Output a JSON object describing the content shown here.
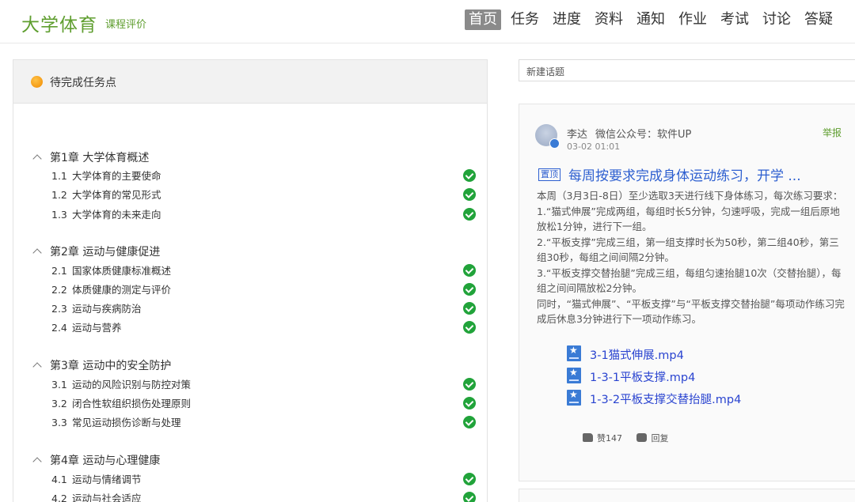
{
  "header": {
    "brand": "大学体育",
    "subtitle": "课程评价",
    "nav": [
      "首页",
      "任务",
      "进度",
      "资料",
      "通知",
      "作业",
      "考试",
      "讨论",
      "答疑"
    ],
    "active_nav": "首页"
  },
  "tasks": {
    "title": "待完成任务点",
    "chapters": [
      {
        "title": "第1章 大学体育概述",
        "lessons": [
          {
            "num": "1.1",
            "title": "大学体育的主要使命",
            "done": true
          },
          {
            "num": "1.2",
            "title": "大学体育的常见形式",
            "done": true
          },
          {
            "num": "1.3",
            "title": "大学体育的未来走向",
            "done": true
          }
        ]
      },
      {
        "title": "第2章 运动与健康促进",
        "lessons": [
          {
            "num": "2.1",
            "title": "国家体质健康标准概述",
            "done": true
          },
          {
            "num": "2.2",
            "title": "体质健康的测定与评价",
            "done": true
          },
          {
            "num": "2.3",
            "title": "运动与疾病防治",
            "done": true
          },
          {
            "num": "2.4",
            "title": "运动与营养",
            "done": true
          }
        ]
      },
      {
        "title": "第3章 运动中的安全防护",
        "lessons": [
          {
            "num": "3.1",
            "title": "运动的风险识别与防控对策",
            "done": true
          },
          {
            "num": "3.2",
            "title": "闭合性软组织损伤处理原则",
            "done": true
          },
          {
            "num": "3.3",
            "title": "常见运动损伤诊断与处理",
            "done": true
          }
        ]
      },
      {
        "title": "第4章 运动与心理健康",
        "lessons": [
          {
            "num": "4.1",
            "title": "运动与情绪调节",
            "done": true
          },
          {
            "num": "4.2",
            "title": "运动与社会适应",
            "done": true
          }
        ]
      }
    ]
  },
  "discussion": {
    "new_topic_placeholder": "新建话题",
    "post": {
      "author": "李达",
      "source": "微信公众号：软件UP",
      "time": "03-02 01:01",
      "report": "举报",
      "pin_label": "置顶",
      "title": "每周按要求完成身体运动练习，开学 ...",
      "body": [
        "本周（3月3日-8日）至少选取3天进行线下身体练习，每次练习要求：",
        "1.“猫式伸展”完成两组，每组时长5分钟，匀速呼吸，完成一组后原地放松1分钟，进行下一组。",
        "2.“平板支撑”完成三组，第一组支撑时长为50秒，第二组40秒，第三组30秒，每组之间间隔2分钟。",
        "3.“平板支撑交替抬腿”完成三组，每组匀速抬腿10次（交替抬腿），每组之间间隔放松2分钟。",
        "同时，“猫式伸展”、“平板支撑”与“平板支撑交替抬腿”每项动作练习完成后休息3分钟进行下一项动作练习。"
      ],
      "attachments": [
        "3-1猫式伸展.mp4",
        "1-3-1平板支撑.mp4",
        "1-3-2平板支撑交替抬腿.mp4"
      ],
      "likes": "赞147",
      "reply": "回复"
    }
  },
  "colors": {
    "brand_green": "#5f9e2f",
    "check_green": "#21a33a",
    "link_blue": "#2d5fd0",
    "active_nav_bg": "#8a8a8a"
  }
}
